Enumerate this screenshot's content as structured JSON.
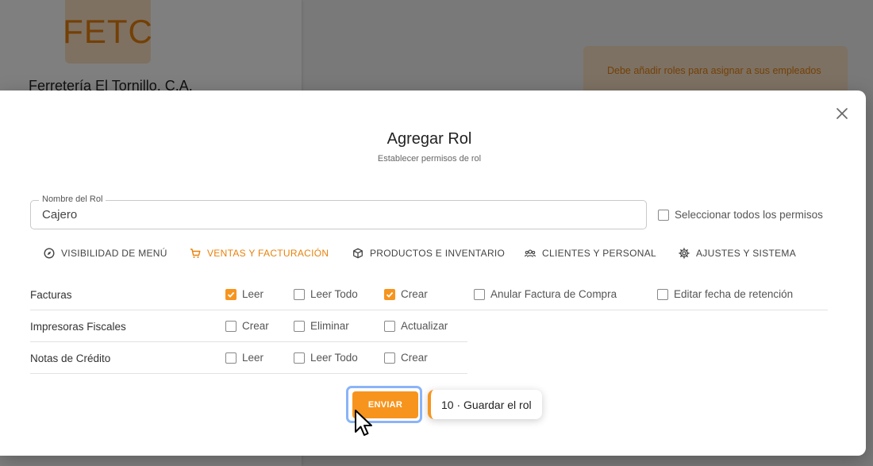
{
  "background": {
    "logo_text": "FETC",
    "company_name": "Ferretería El Tornillo, C.A.",
    "alert_text": "Debe añadir roles para asignar a sus empleados"
  },
  "modal": {
    "title": "Agregar Rol",
    "subtitle": "Establecer permisos de rol",
    "close_icon": "close-icon"
  },
  "role_field": {
    "label": "Nombre del Rol",
    "value": "Cajero"
  },
  "select_all": {
    "label": "Seleccionar todos los permisos",
    "checked": false
  },
  "tabs": [
    {
      "label": "VISIBILIDAD DE MENÚ",
      "icon": "compass-icon",
      "active": false
    },
    {
      "label": "VENTAS Y FACTURACIÓN",
      "icon": "cart-icon",
      "active": true
    },
    {
      "label": "PRODUCTOS E INVENTARIO",
      "icon": "box-icon",
      "active": false
    },
    {
      "label": "CLIENTES Y PERSONAL",
      "icon": "people-icon",
      "active": false
    },
    {
      "label": "AJUSTES Y SISTEMA",
      "icon": "gear-icon",
      "active": false
    }
  ],
  "permissions": [
    {
      "name": "Facturas",
      "options": [
        {
          "label": "Leer",
          "checked": true
        },
        {
          "label": "Leer Todo",
          "checked": false
        },
        {
          "label": "Crear",
          "checked": true
        },
        {
          "label": "Anular Factura de Compra",
          "checked": false
        },
        {
          "label": "Editar fecha de retención",
          "checked": false
        }
      ]
    },
    {
      "name": "Impresoras Fiscales",
      "options": [
        {
          "label": "Crear",
          "checked": false
        },
        {
          "label": "Eliminar",
          "checked": false
        },
        {
          "label": "Actualizar",
          "checked": false
        }
      ]
    },
    {
      "name": "Notas de Crédito",
      "options": [
        {
          "label": "Leer",
          "checked": false
        },
        {
          "label": "Leer Todo",
          "checked": false
        },
        {
          "label": "Crear",
          "checked": false
        }
      ]
    }
  ],
  "submit_label": "ENVIAR",
  "tooltip_text": "10 · Guardar el rol",
  "colors": {
    "accent": "#f7941d",
    "accent_text": "#e8810c",
    "focus_ring": "#8ab4f8"
  }
}
